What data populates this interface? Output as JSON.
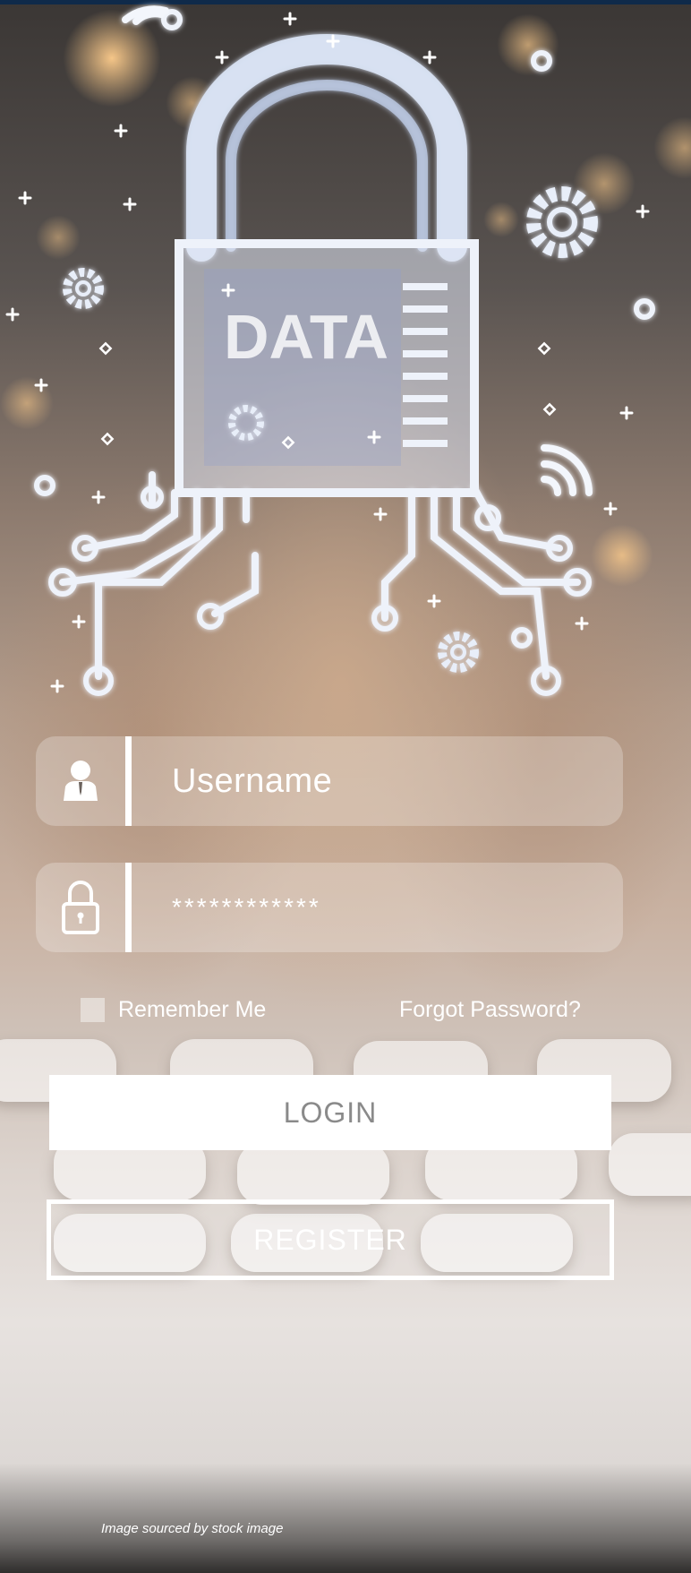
{
  "hero": {
    "lock_label": "DATA",
    "icons": [
      "padlock-circuit-icon",
      "gear-icon",
      "wifi-icon"
    ]
  },
  "login_form": {
    "username": {
      "placeholder": "Username",
      "icon": "user-icon"
    },
    "password": {
      "value": "************",
      "icon": "lock-icon"
    },
    "remember_me": {
      "label": "Remember Me",
      "checked": false
    },
    "forgot_password": "Forgot Password?",
    "login_label": "LOGIN",
    "register_label": "REGISTER"
  },
  "footer": {
    "credit": "Image sourced by stock image"
  },
  "colors": {
    "accent": "#ffffff",
    "topbar": "#0f2a4a",
    "login_text": "#8a8a8a"
  }
}
